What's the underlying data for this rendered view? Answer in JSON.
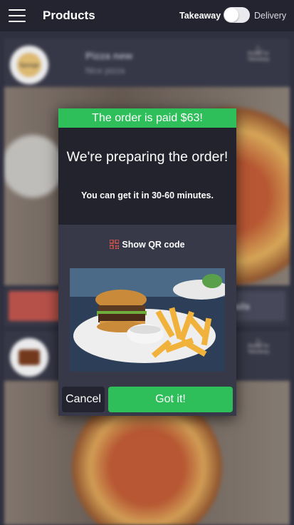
{
  "header": {
    "title": "Products",
    "mode_takeaway": "Takeaway",
    "mode_delivery": "Delivery",
    "toggle_selected": "Takeaway"
  },
  "products": [
    {
      "name": "Pizza new",
      "description": "Nice pizza",
      "logo_text": "Sponge",
      "badge": "Ready for Takeaway",
      "details_label": "Details"
    },
    {
      "name": "",
      "description": "",
      "logo_text": "",
      "badge": "Ready for Takeaway",
      "details_label": ""
    }
  ],
  "modal": {
    "banner": "The order is paid $63!",
    "heading": "We're preparing the order!",
    "subtext": "You can get it in 30-60 minutes.",
    "qr_label": "Show QR code",
    "cancel_label": "Cancel",
    "ok_label": "Got it!"
  },
  "colors": {
    "accent_green": "#2ebe5a",
    "header_bg": "#23242f",
    "modal_bg": "#373848",
    "qr_icon": "#e0554a"
  },
  "icons": {
    "menu": "hamburger-icon",
    "qr": "qr-code-icon",
    "badge": "takeaway-badge-icon"
  }
}
